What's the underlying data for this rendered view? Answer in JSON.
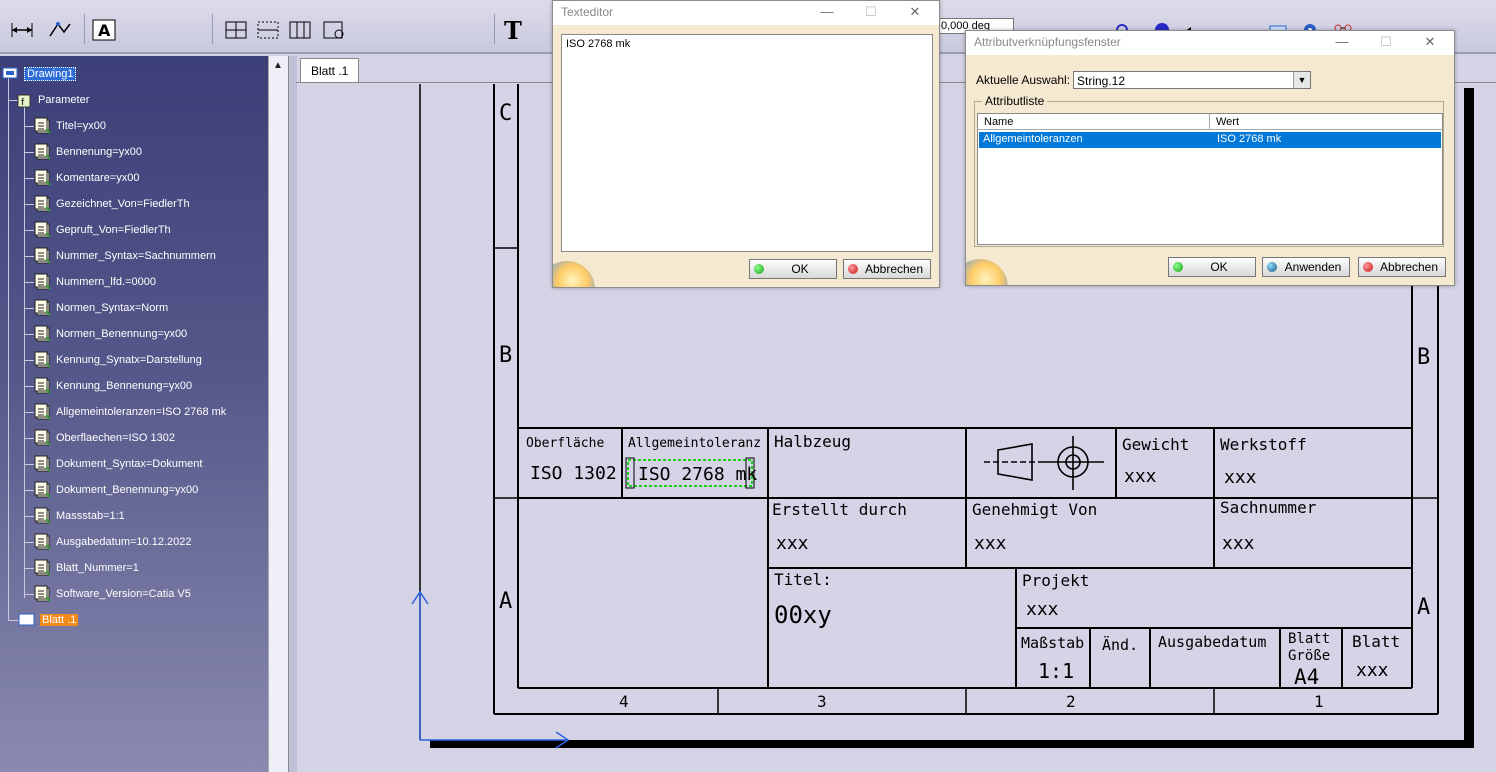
{
  "toolbar": {
    "angle_field": "0,000 deg"
  },
  "tree": {
    "root": "Drawing1",
    "parameter_group": "Parameter",
    "parameters": [
      "Titel=yx00",
      "Bennenung=yx00",
      "Komentare=yx00",
      "Gezeichnet_Von=FiedlerTh",
      "Gepruft_Von=FiedlerTh",
      "Nummer_Syntax=Sachnummern",
      "Nummern_lfd.=0000",
      "Normen_Syntax=Norm",
      "Normen_Benennung=yx00",
      "Kennung_Synatx=Darstellung",
      "Kennung_Bennenung=yx00",
      "Allgemeintoleranzen=ISO 2768 mk",
      "Oberflaechen=ISO 1302",
      "Dokument_Syntax=Dokument",
      "Dokument_Benennung=yx00",
      "Massstab=1:1",
      "Ausgabedatum=10.12.2022",
      "Blatt_Nummer=1",
      "Software_Version=Catia V5"
    ],
    "sheet": "Blatt .1"
  },
  "sheet_tab": "Blatt .1",
  "drawing": {
    "zone_letters": {
      "c": "C",
      "b": "B",
      "a": "A"
    },
    "column_numbers": [
      "4",
      "3",
      "2",
      "1"
    ],
    "title_block": {
      "oberflaeche_label": "Oberfläche",
      "oberflaeche_value": "ISO 1302",
      "allgemeintoleranz_label": "Allgemeintoleranz",
      "allgemeintoleranz_value": "ISO 2768 mk",
      "halbzeug_label": "Halbzeug",
      "gewicht_label": "Gewicht",
      "gewicht_value": "xxx",
      "werkstoff_label": "Werkstoff",
      "werkstoff_value": "xxx",
      "erstellt_label": "Erstellt durch",
      "erstellt_value": "xxx",
      "genehmigt_label": "Genehmigt Von",
      "genehmigt_value": "xxx",
      "sachnummer_label": "Sachnummer",
      "sachnummer_value": "xxx",
      "titel_label": "Titel:",
      "titel_value": "00xy",
      "projekt_label": "Projekt",
      "projekt_value": "xxx",
      "massstab_label": "Maßstab",
      "massstab_value": "1:1",
      "aend_label": "Änd.",
      "ausgabedatum_label": "Ausgabedatum",
      "blatt_groesse_label_1": "Blatt",
      "blatt_groesse_label_2": "Größe",
      "blatt_groesse_value": "A4",
      "blatt_label": "Blatt",
      "blatt_value": "xxx"
    }
  },
  "text_editor": {
    "title": "Texteditor",
    "content": "ISO 2768 mk",
    "ok": "OK",
    "cancel": "Abbrechen"
  },
  "attr_window": {
    "title": "Attributverknüpfungsfenster",
    "selection_label": "Aktuelle Auswahl:",
    "selection_value": "String.12",
    "group_label": "Attributliste",
    "columns": [
      "Name",
      "Wert"
    ],
    "rows": [
      {
        "name": "Allgemeintoleranzen",
        "value": "ISO 2768 mk"
      }
    ],
    "ok": "OK",
    "apply": "Anwenden",
    "cancel": "Abbrechen"
  },
  "colors": {
    "selection": "#0078d7",
    "tree_bg": "#3c3f78",
    "dialog_bg": "#f6e9d2",
    "sheet_highlight": "#f08a1a"
  }
}
